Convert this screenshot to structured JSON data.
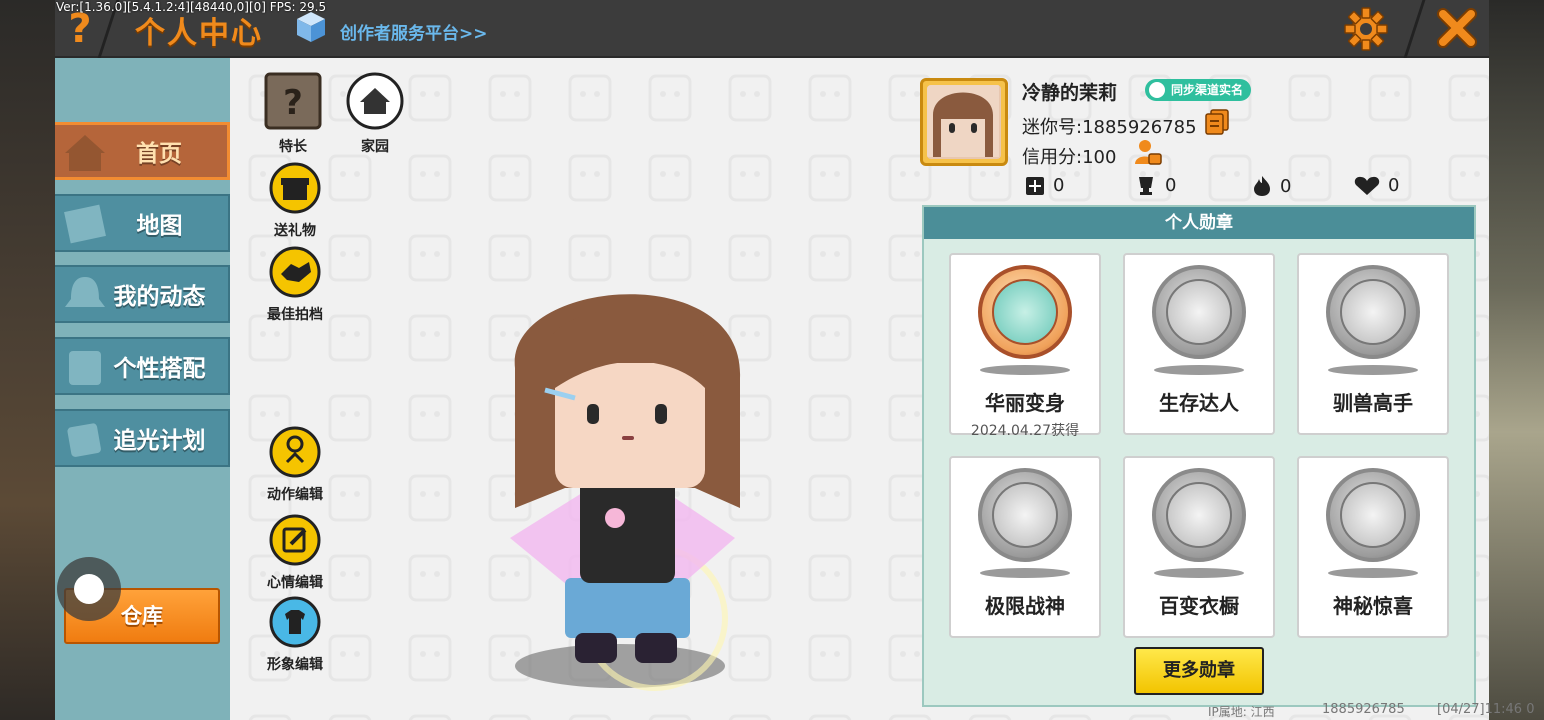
{
  "debug": {
    "text": "Ver:[1.36.0][5.4.1.2:4][48440,0][0] FPS: 29.5"
  },
  "topbar": {
    "help_icon": "question-icon",
    "title": "个人中心",
    "creator_link": "创作者服务平台>>",
    "settings_icon": "gear-icon",
    "close_icon": "close-icon",
    "accent": "#f08a1c"
  },
  "sidebar": {
    "items": [
      {
        "label": "首页",
        "icon": "house-icon",
        "active": true
      },
      {
        "label": "地图",
        "icon": "map-icon",
        "active": false
      },
      {
        "label": "我的动态",
        "icon": "bell-icon",
        "active": false
      },
      {
        "label": "个性搭配",
        "icon": "outfit-icon",
        "active": false
      },
      {
        "label": "追光计划",
        "icon": "plan-icon",
        "active": false
      }
    ],
    "warehouse_label": "仓库"
  },
  "tools": {
    "specialty": "特长",
    "home": "家园",
    "gift": "送礼物",
    "best_shot": "最佳拍档",
    "action_edit": "动作编辑",
    "mood_edit": "心情编辑",
    "image_edit": "形象编辑"
  },
  "profile": {
    "username": "冷静的茉莉",
    "realname_badge": "同步渠道实名",
    "mini_id": "迷你号:1885926785",
    "credit": "信用分:100",
    "stats": [
      {
        "icon": "add-friend-icon",
        "value": "0"
      },
      {
        "icon": "trophy-icon",
        "value": "0"
      },
      {
        "icon": "fire-icon",
        "value": "0"
      },
      {
        "icon": "heart-icon",
        "value": "0"
      }
    ]
  },
  "medals": {
    "title": "个人勋章",
    "items": [
      {
        "name": "华丽变身",
        "date": "2024.04.27获得",
        "earned": true
      },
      {
        "name": "生存达人",
        "date": "",
        "earned": false
      },
      {
        "name": "驯兽高手",
        "date": "",
        "earned": false
      },
      {
        "name": "极限战神",
        "date": "",
        "earned": false
      },
      {
        "name": "百变衣橱",
        "date": "",
        "earned": false
      },
      {
        "name": "神秘惊喜",
        "date": "",
        "earned": false
      }
    ],
    "more_label": "更多勋章"
  },
  "footer": {
    "ip": "IP属地: 江西",
    "id": "1885926785",
    "time": "[04/27]11:46 0"
  }
}
